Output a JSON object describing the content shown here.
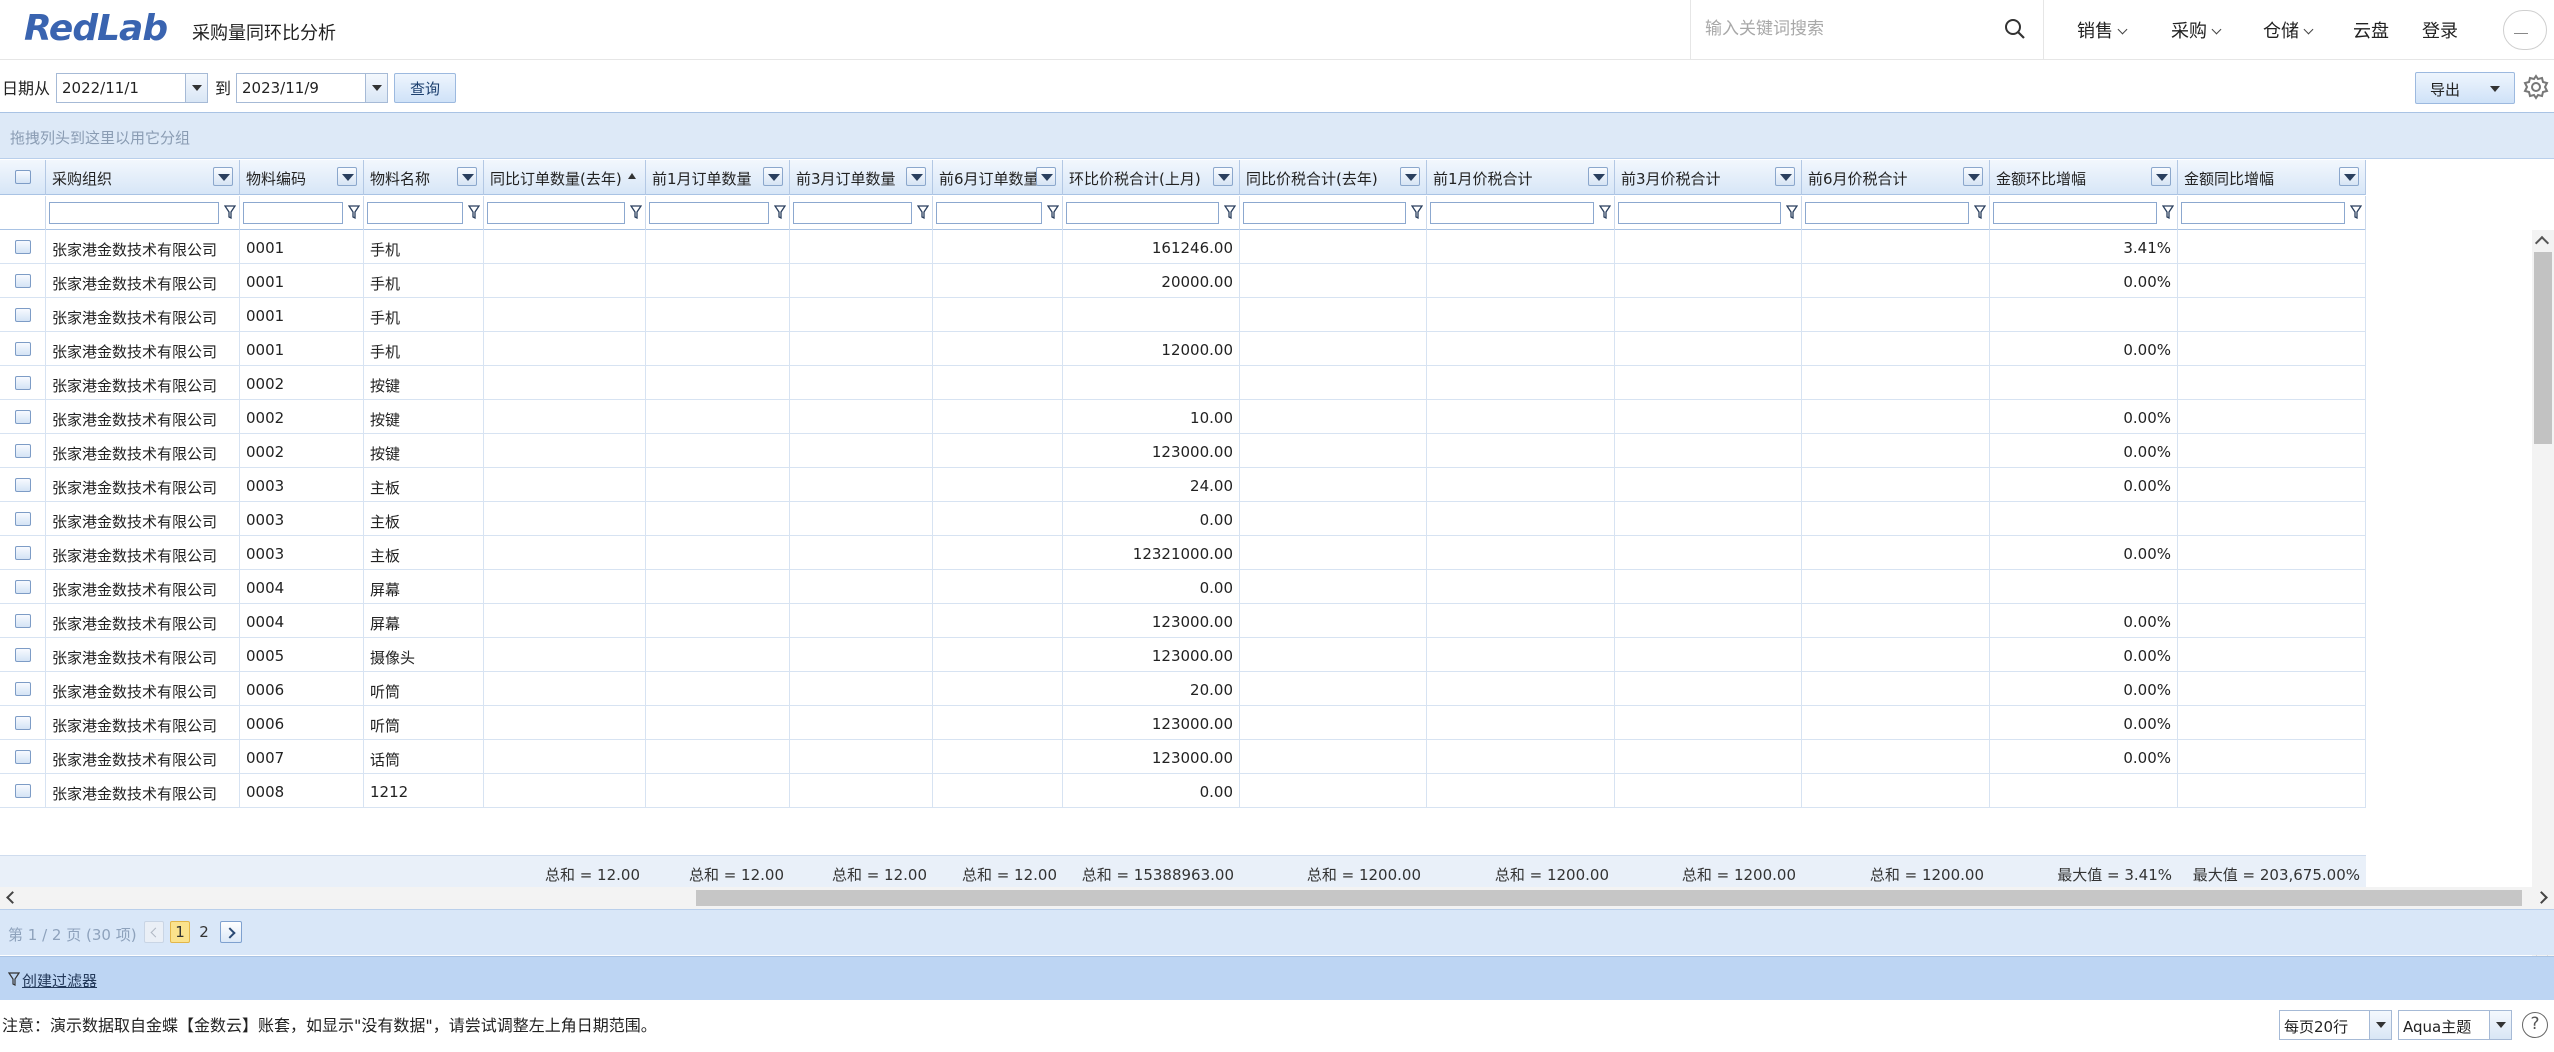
{
  "header": {
    "logo": "RedLab",
    "page_title": "采购量同环比分析",
    "search_placeholder": "输入关键词搜索",
    "nav": [
      {
        "label": "销售",
        "has_caret": true
      },
      {
        "label": "采购",
        "has_caret": true
      },
      {
        "label": "仓储",
        "has_caret": true
      },
      {
        "label": "云盘",
        "has_caret": false
      },
      {
        "label": "登录",
        "has_caret": false
      }
    ]
  },
  "toolbar": {
    "date_from_label": "日期从",
    "date_from": "2022/11/1",
    "to_label": "到",
    "date_to": "2023/11/9",
    "query_label": "查询",
    "export_label": "导出"
  },
  "grid": {
    "group_panel_text": "拖拽列头到这里以用它分组",
    "columns": [
      "采购组织",
      "物料编码",
      "物料名称",
      "同比订单数量(去年)",
      "前1月订单数量",
      "前3月订单数量",
      "前6月订单数量",
      "环比价税合计(上月)",
      "同比价税合计(去年)",
      "前1月价税合计",
      "前3月价税合计",
      "前6月价税合计",
      "金额环比增幅",
      "金额同比增幅"
    ],
    "rows": [
      [
        "张家港金数技术有限公司",
        "0001",
        "手机",
        "",
        "",
        "",
        "",
        "161246.00",
        "",
        "",
        "",
        "",
        "3.41%",
        ""
      ],
      [
        "张家港金数技术有限公司",
        "0001",
        "手机",
        "",
        "",
        "",
        "",
        "20000.00",
        "",
        "",
        "",
        "",
        "0.00%",
        ""
      ],
      [
        "张家港金数技术有限公司",
        "0001",
        "手机",
        "",
        "",
        "",
        "",
        "",
        "",
        "",
        "",
        "",
        "",
        ""
      ],
      [
        "张家港金数技术有限公司",
        "0001",
        "手机",
        "",
        "",
        "",
        "",
        "12000.00",
        "",
        "",
        "",
        "",
        "0.00%",
        ""
      ],
      [
        "张家港金数技术有限公司",
        "0002",
        "按键",
        "",
        "",
        "",
        "",
        "",
        "",
        "",
        "",
        "",
        "",
        ""
      ],
      [
        "张家港金数技术有限公司",
        "0002",
        "按键",
        "",
        "",
        "",
        "",
        "10.00",
        "",
        "",
        "",
        "",
        "0.00%",
        ""
      ],
      [
        "张家港金数技术有限公司",
        "0002",
        "按键",
        "",
        "",
        "",
        "",
        "123000.00",
        "",
        "",
        "",
        "",
        "0.00%",
        ""
      ],
      [
        "张家港金数技术有限公司",
        "0003",
        "主板",
        "",
        "",
        "",
        "",
        "24.00",
        "",
        "",
        "",
        "",
        "0.00%",
        ""
      ],
      [
        "张家港金数技术有限公司",
        "0003",
        "主板",
        "",
        "",
        "",
        "",
        "0.00",
        "",
        "",
        "",
        "",
        "",
        ""
      ],
      [
        "张家港金数技术有限公司",
        "0003",
        "主板",
        "",
        "",
        "",
        "",
        "12321000.00",
        "",
        "",
        "",
        "",
        "0.00%",
        ""
      ],
      [
        "张家港金数技术有限公司",
        "0004",
        "屏幕",
        "",
        "",
        "",
        "",
        "0.00",
        "",
        "",
        "",
        "",
        "",
        ""
      ],
      [
        "张家港金数技术有限公司",
        "0004",
        "屏幕",
        "",
        "",
        "",
        "",
        "123000.00",
        "",
        "",
        "",
        "",
        "0.00%",
        ""
      ],
      [
        "张家港金数技术有限公司",
        "0005",
        "摄像头",
        "",
        "",
        "",
        "",
        "123000.00",
        "",
        "",
        "",
        "",
        "0.00%",
        ""
      ],
      [
        "张家港金数技术有限公司",
        "0006",
        "听筒",
        "",
        "",
        "",
        "",
        "20.00",
        "",
        "",
        "",
        "",
        "0.00%",
        ""
      ],
      [
        "张家港金数技术有限公司",
        "0006",
        "听筒",
        "",
        "",
        "",
        "",
        "123000.00",
        "",
        "",
        "",
        "",
        "0.00%",
        ""
      ],
      [
        "张家港金数技术有限公司",
        "0007",
        "话筒",
        "",
        "",
        "",
        "",
        "123000.00",
        "",
        "",
        "",
        "",
        "0.00%",
        ""
      ],
      [
        "张家港金数技术有限公司",
        "0008",
        "1212",
        "",
        "",
        "",
        "",
        "0.00",
        "",
        "",
        "",
        "",
        "",
        ""
      ]
    ],
    "footer": [
      "",
      "",
      "",
      "总和 = 12.00",
      "总和 = 12.00",
      "总和 = 12.00",
      "总和 = 12.00",
      "总和 = 15388963.00",
      "总和 = 1200.00",
      "总和 = 1200.00",
      "总和 = 1200.00",
      "总和 = 1200.00",
      "最大值 = 3.41%",
      "最大值 = 203,675.00%"
    ]
  },
  "pager": {
    "info": "第 1 / 2 页 (30 项)",
    "pages": [
      "1",
      "2"
    ],
    "create_filter": "创建过滤器"
  },
  "footer_bar": {
    "notice": "注意：演示数据取自金蝶【金数云】账套，如显示\"没有数据\"，请尝试调整左上角日期范围。",
    "page_size": "每页20行",
    "theme": "Aqua主题",
    "help": "?"
  },
  "colors": {
    "brand": "#3a64b0",
    "grid_header": "#d7e6f7",
    "pager_bg": "#d9e7f8",
    "current_page": "#fbe28c"
  }
}
